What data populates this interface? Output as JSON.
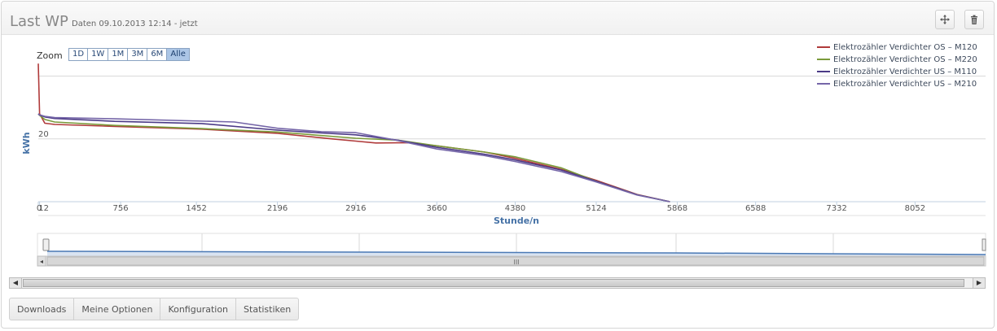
{
  "panel": {
    "title": "Last WP",
    "subtitle": "Daten 09.10.2013 12:14 - jetzt",
    "move_icon": "move-icon",
    "delete_icon": "trash-icon"
  },
  "zoom": {
    "label": "Zoom",
    "buttons": [
      "1D",
      "1W",
      "1M",
      "3M",
      "6M",
      "Alle"
    ],
    "selected": "Alle"
  },
  "chart_data": {
    "type": "line",
    "xlabel": "Stunde/n",
    "ylabel": "kWh",
    "xlim": [
      0,
      8700
    ],
    "ylim": [
      0,
      50
    ],
    "x_ticks": [
      0,
      12,
      756,
      1452,
      2196,
      2916,
      3660,
      4380,
      5124,
      5868,
      6588,
      7332,
      8052
    ],
    "x_tick_labels": [
      "0",
      "12",
      "756",
      "1452",
      "2196",
      "2916",
      "3660",
      "4380",
      "5124",
      "5868",
      "6588",
      "7332",
      "8052"
    ],
    "y_ticks": [
      20
    ],
    "y_tick_labels": [
      "20"
    ],
    "grid": true,
    "legend_position": "top-right",
    "series": [
      {
        "name": "Elektrozähler Verdichter OS – M120",
        "color": "#b03a3a",
        "x": [
          0,
          12,
          60,
          150,
          700,
          1500,
          2196,
          2700,
          2916,
          3100,
          3400,
          3660,
          4100,
          4380,
          4800,
          5124,
          5500,
          5800
        ],
        "y": [
          44,
          28,
          25,
          24.6,
          24,
          23.1,
          21.8,
          20,
          19.3,
          18.7,
          18.8,
          17.8,
          15.8,
          13.8,
          10.3,
          6.8,
          2.3,
          0
        ]
      },
      {
        "name": "Elektrozähler Verdichter OS – M220",
        "color": "#7a9a3a",
        "x": [
          0,
          12,
          60,
          150,
          700,
          1500,
          2196,
          2916,
          3300,
          3660,
          4100,
          4380,
          4800,
          5124,
          5500,
          5800
        ],
        "y": [
          28,
          27.5,
          26.2,
          25.4,
          24.3,
          23.3,
          22.2,
          20.2,
          19.6,
          17.8,
          15.8,
          14.3,
          10.8,
          6.5,
          2.2,
          0
        ]
      },
      {
        "name": "Elektrozähler Verdichter US – M110",
        "color": "#4b3a86",
        "x": [
          0,
          12,
          60,
          150,
          700,
          1500,
          2196,
          2600,
          2916,
          3300,
          3660,
          4100,
          4380,
          4800,
          5124,
          5500,
          5800
        ],
        "y": [
          28,
          27.6,
          27,
          26.5,
          25.6,
          24.9,
          22.8,
          21.9,
          21.3,
          19.6,
          17.3,
          15.1,
          13.3,
          10.1,
          6.5,
          2.2,
          0
        ]
      },
      {
        "name": "Elektrozähler Verdichter US – M210",
        "color": "#7566a8",
        "x": [
          0,
          12,
          60,
          150,
          700,
          1800,
          2196,
          2600,
          2916,
          3300,
          3660,
          4100,
          4380,
          4800,
          5124,
          5500,
          5800
        ],
        "y": [
          28,
          27.7,
          27.2,
          26.8,
          26.4,
          25.4,
          23.4,
          22.3,
          22,
          19.5,
          16.8,
          14.7,
          12.8,
          9.6,
          6.3,
          2.1,
          0
        ]
      }
    ]
  },
  "navigator": {
    "scroll_label": "III"
  },
  "tabs": [
    "Downloads",
    "Meine Optionen",
    "Konfiguration",
    "Statistiken"
  ]
}
